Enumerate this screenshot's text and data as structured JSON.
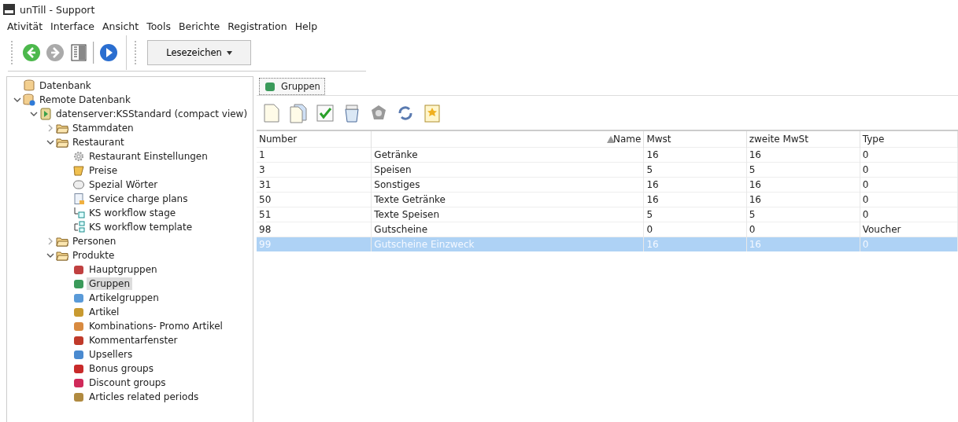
{
  "window": {
    "title": "unTill - Support"
  },
  "menu": [
    "Ativität",
    "Interface",
    "Ansicht",
    "Tools",
    "Berichte",
    "Registration",
    "Help"
  ],
  "toolbar": {
    "buttons": [
      {
        "kind": "back",
        "disabled": false
      },
      {
        "kind": "forward",
        "disabled": true
      },
      {
        "kind": "columns",
        "disabled": false
      },
      {
        "kind": "play",
        "disabled": false
      }
    ],
    "bookmarks": "Lesezeichen"
  },
  "tree": [
    {
      "label": "Datenbank",
      "kind": "database",
      "selected": false
    },
    {
      "label": "Remote Datenbank",
      "kind": "remote",
      "selected": false,
      "expanded": true,
      "children": [
        {
          "label": "datenserver:KSStandard (compact view)",
          "kind": "server",
          "selected": false,
          "expanded": true,
          "children": [
            {
              "label": "Stammdaten",
              "kind": "folder",
              "selected": false,
              "expanded": false
            },
            {
              "label": "Restaurant",
              "kind": "folder",
              "selected": false,
              "expanded": true,
              "children": [
                {
                  "label": "Restaurant Einstellungen",
                  "kind": "gear",
                  "selected": false
                },
                {
                  "label": "Preise",
                  "kind": "price",
                  "selected": false
                },
                {
                  "label": "Spezial Wörter",
                  "kind": "words",
                  "selected": false
                },
                {
                  "label": "Service charge plans",
                  "kind": "doc",
                  "selected": false
                },
                {
                  "label": "KS workflow stage",
                  "kind": "stage",
                  "selected": false
                },
                {
                  "label": "KS workflow template",
                  "kind": "template",
                  "selected": false
                }
              ]
            },
            {
              "label": "Personen",
              "kind": "folder",
              "selected": false,
              "expanded": false
            },
            {
              "label": "Produkte",
              "kind": "folder",
              "selected": false,
              "expanded": true,
              "children": [
                {
                  "label": "Hauptgruppen",
                  "kind": "item",
                  "color": "#c04040",
                  "selected": false
                },
                {
                  "label": "Gruppen",
                  "kind": "item",
                  "color": "#3a9a5a",
                  "selected": true
                },
                {
                  "label": "Artikelgruppen",
                  "kind": "item",
                  "color": "#5a9ad8",
                  "selected": false
                },
                {
                  "label": "Artikel",
                  "kind": "item",
                  "color": "#c89a30",
                  "selected": false
                },
                {
                  "label": "Kombinations- Promo Artikel",
                  "kind": "item",
                  "color": "#d88a40",
                  "selected": false
                },
                {
                  "label": "Kommentarfenster",
                  "kind": "item",
                  "color": "#c03a2a",
                  "selected": false
                },
                {
                  "label": "Upsellers",
                  "kind": "item",
                  "color": "#4a8ad0",
                  "selected": false
                },
                {
                  "label": "Bonus groups",
                  "kind": "item",
                  "color": "#c82a2a",
                  "selected": false
                },
                {
                  "label": "Discount groups",
                  "kind": "item",
                  "color": "#d02a5a",
                  "selected": false
                },
                {
                  "label": "Articles related periods",
                  "kind": "item",
                  "color": "#b08a40",
                  "selected": false
                }
              ]
            }
          ]
        }
      ]
    }
  ],
  "tab": {
    "label": "Gruppen"
  },
  "table": {
    "columns": [
      {
        "label": "Number",
        "sorted": false
      },
      {
        "label": "Name",
        "sorted": true
      },
      {
        "label": "Mwst",
        "sorted": false
      },
      {
        "label": "zweite MwSt",
        "sorted": false
      },
      {
        "label": "Type",
        "sorted": false
      }
    ],
    "rows": [
      {
        "cells": [
          "1",
          "Getränke",
          "16",
          "16",
          "0"
        ],
        "selected": false
      },
      {
        "cells": [
          "3",
          "Speisen",
          "5",
          "5",
          "0"
        ],
        "selected": false
      },
      {
        "cells": [
          "31",
          "Sonstiges",
          "16",
          "16",
          "0"
        ],
        "selected": false
      },
      {
        "cells": [
          "50",
          "Texte Getränke",
          "16",
          "16",
          "0"
        ],
        "selected": false
      },
      {
        "cells": [
          "51",
          "Texte Speisen",
          "5",
          "5",
          "0"
        ],
        "selected": false
      },
      {
        "cells": [
          "98",
          "Gutscheine",
          "0",
          "0",
          "Voucher"
        ],
        "selected": false
      },
      {
        "cells": [
          "99",
          "Gutscheine Einzweck",
          "16",
          "16",
          "0"
        ],
        "selected": true
      }
    ]
  }
}
